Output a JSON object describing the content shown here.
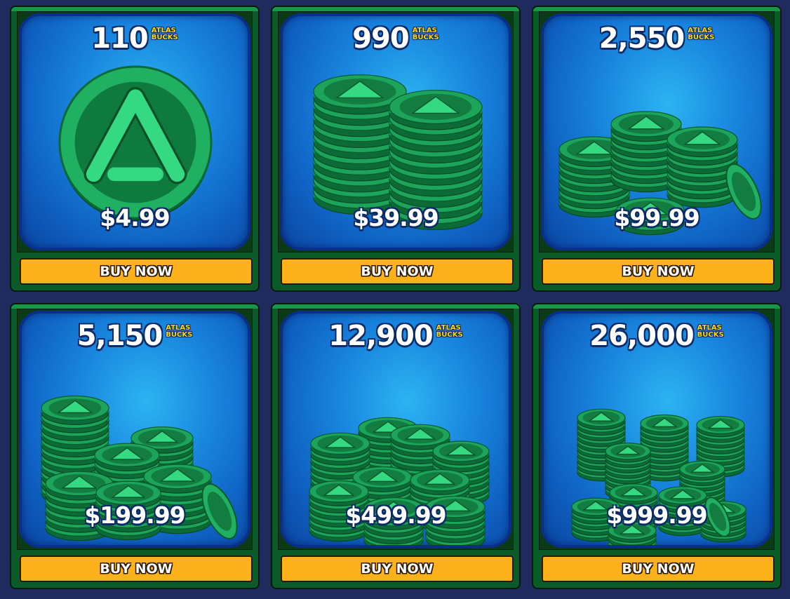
{
  "currency": {
    "line1": "ATLAS",
    "line2": "BUCKS"
  },
  "colors": {
    "background": "#1f2b5c",
    "card_green": "#0b5a2a",
    "panel_blue": "#1884dd",
    "coin_green": "#1fb062",
    "buy_button": "#fdb11a"
  },
  "packs": [
    {
      "amount": "110",
      "price": "$4.99",
      "buy_label": "BUY NOW",
      "icon": "single-coin-icon"
    },
    {
      "amount": "990",
      "price": "$39.99",
      "buy_label": "BUY NOW",
      "icon": "coin-stacks-icon"
    },
    {
      "amount": "2,550",
      "price": "$99.99",
      "buy_label": "BUY NOW",
      "icon": "coin-stacks-icon"
    },
    {
      "amount": "5,150",
      "price": "$199.99",
      "buy_label": "BUY NOW",
      "icon": "coin-pile-icon"
    },
    {
      "amount": "12,900",
      "price": "$499.99",
      "buy_label": "BUY NOW",
      "icon": "coin-pile-icon"
    },
    {
      "amount": "26,000",
      "price": "$999.99",
      "buy_label": "BUY NOW",
      "icon": "coin-pile-icon"
    }
  ]
}
